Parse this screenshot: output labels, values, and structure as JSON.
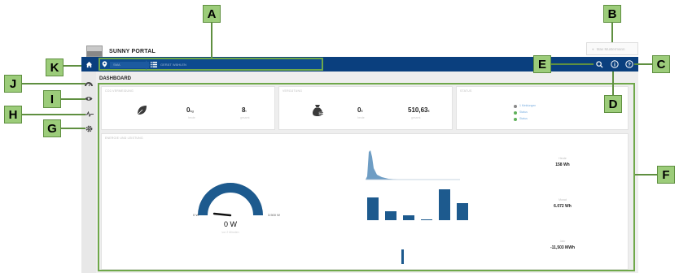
{
  "app": {
    "brand": "SUNNY PORTAL",
    "user_label": "Max Mustermann"
  },
  "breadcrumb": {
    "plant": "SMA",
    "view": "GERÄT WÄHLEN"
  },
  "page": {
    "title": "DASHBOARD"
  },
  "cards": {
    "co2": {
      "title": "CO2-VERMEIDUNG",
      "value1": "0",
      "unit1": "kg",
      "sub1": "heute",
      "value2": "8",
      "unit2": "t",
      "sub2": "gesamt"
    },
    "revenue": {
      "title": "VERGÜTUNG",
      "value1": "0",
      "unit1": "€",
      "sub1": "heute",
      "value2": "510,63",
      "unit2": "€",
      "sub2": "gesamt"
    },
    "status": {
      "title": "STATUS",
      "items": [
        "1 Meldungen",
        "Status",
        "Status"
      ]
    },
    "energy": {
      "title": "ENERGIE UND LEISTUNG",
      "gauge": {
        "value": "0 W",
        "min": "0 W",
        "max": "3.500 W",
        "sub": "vor 2 Minuten",
        "level": 0
      },
      "stats": [
        {
          "label": "Heute",
          "value": "158 Wh"
        },
        {
          "label": "Monat",
          "value": "6.072 Wh"
        },
        {
          "label": "Jahr",
          "value": "-11,503 MWh"
        }
      ],
      "bar_chart": {
        "values": [
          28,
          11,
          6,
          1,
          38,
          21
        ],
        "max": 40
      },
      "single_bar": {
        "value": 18,
        "max": 40
      },
      "colors": {
        "primary": "#1d5a8e",
        "area": "#6e9dc4"
      }
    }
  },
  "callouts": [
    "A",
    "B",
    "C",
    "D",
    "E",
    "F",
    "G",
    "H",
    "I",
    "J",
    "K"
  ],
  "colors": {
    "navbar": "#0a3f7e",
    "callout_fill": "#9ccc7a",
    "callout_border": "#5f8f40"
  },
  "icons": {
    "home": "home-icon",
    "location": "location-pin-icon",
    "list": "list-icon",
    "search": "search-icon",
    "info": "info-icon",
    "help": "help-icon",
    "dashboard": "speedometer-icon",
    "monitoring": "eye-icon",
    "analysis": "pulse-icon",
    "config": "gear-icon"
  }
}
